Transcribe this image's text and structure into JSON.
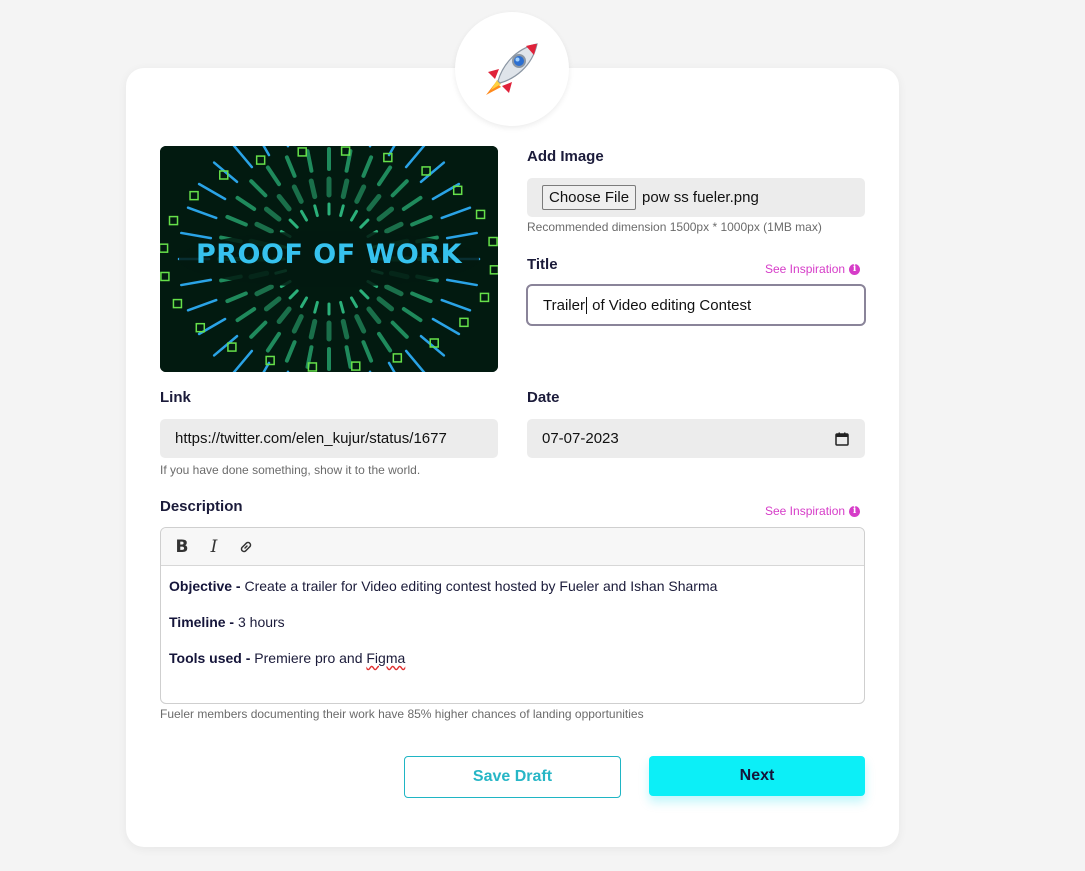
{
  "form": {
    "add_image_label": "Add Image",
    "choose_file_label": "Choose File",
    "file_name": "pow ss fueler.png",
    "image_hint": "Recommended dimension 1500px * 1000px (1MB max)",
    "preview_text": "PROOF OF WORK",
    "title_label": "Title",
    "title_value_before_caret": "Trailer",
    "title_value_after_caret": " of Video editing Contest",
    "see_inspiration": "See Inspiration",
    "link_label": "Link",
    "link_value": "https://twitter.com/elen_kujur/status/1677",
    "link_hint": "If you have done something, show it to the world.",
    "date_label": "Date",
    "date_value": "07-07-2023",
    "description_label": "Description",
    "description": {
      "objective_label": "Objective -",
      "objective_text": " Create a trailer for Video editing contest hosted by Fueler and Ishan Sharma",
      "timeline_label": "Timeline -",
      "timeline_text": " 3 hours",
      "tools_label": "Tools used -",
      "tools_text": " Premiere pro and ",
      "tools_misspelled": "Figma"
    },
    "description_hint": "Fueler members documenting their work have 85% higher chances of landing opportunities",
    "save_draft_label": "Save Draft",
    "next_label": "Next"
  },
  "icons": {
    "badge": "rocket-icon",
    "toolbar": [
      "bold-icon",
      "italic-icon",
      "link-icon"
    ],
    "date": "calendar-icon",
    "info": "info-icon"
  },
  "colors": {
    "accent": "#0ceff7",
    "draft_text": "#27b6c6",
    "inspiration": "#d63cc8",
    "background": "#f4f4f4"
  }
}
